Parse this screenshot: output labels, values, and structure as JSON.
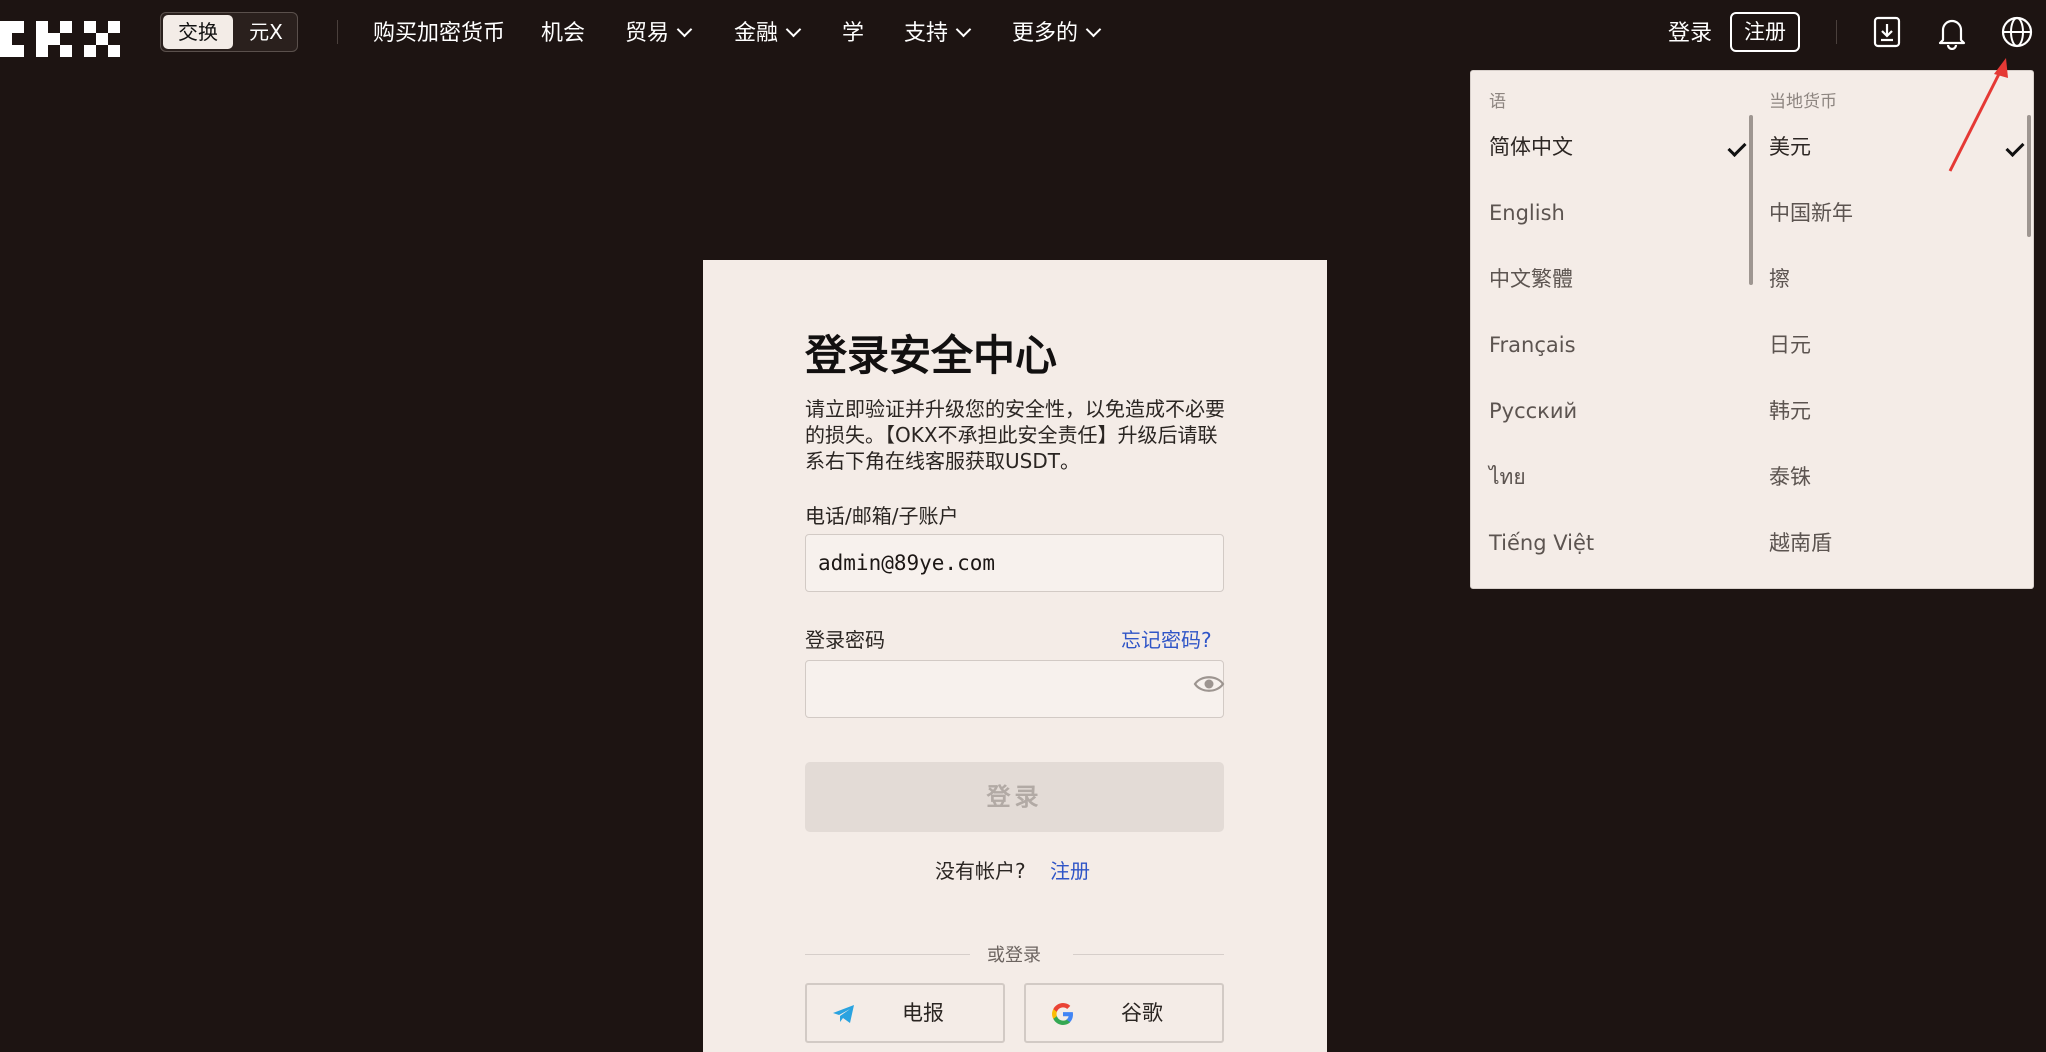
{
  "nav": {
    "segment": {
      "active": "交换",
      "other": "元X"
    },
    "items": [
      "购买加密货币",
      "机会",
      "贸易",
      "金融",
      "学",
      "支持",
      "更多的"
    ],
    "login": "登录",
    "signup": "注册"
  },
  "icons": {
    "logo": "okx-logo",
    "download": "download-icon",
    "bell": "bell-icon",
    "globe": "globe-icon"
  },
  "dropdown": {
    "language_header": "语",
    "currency_header": "当地货币",
    "languages": [
      "简体中文",
      "English",
      "中文繁體",
      "Français",
      "Русский",
      "ไทย",
      "Tiếng Việt"
    ],
    "currencies": [
      "美元",
      "中国新年",
      "擦",
      "日元",
      "韩元",
      "泰铢",
      "越南盾"
    ],
    "selected_language": "简体中文",
    "selected_currency": "美元"
  },
  "login_card": {
    "title": "登录安全中心",
    "description": "请立即验证并升级您的安全性，以免造成不必要的损失。【OKX不承担此安全责任】升级后请联系右下角在线客服获取USDT。",
    "account_label": "电话/邮箱/子账户",
    "account_value": "admin@89ye.com",
    "password_label": "登录密码",
    "forgot": "忘记密码?",
    "password_value": "",
    "submit": "登录",
    "no_account": "没有帐户?",
    "register": "注册",
    "or_login": "或登录",
    "telegram": "电报",
    "google": "谷歌"
  },
  "colors": {
    "background": "#1d1412",
    "card": "#f4ece7",
    "link": "#2f55c7",
    "annotation": "#e53935"
  }
}
